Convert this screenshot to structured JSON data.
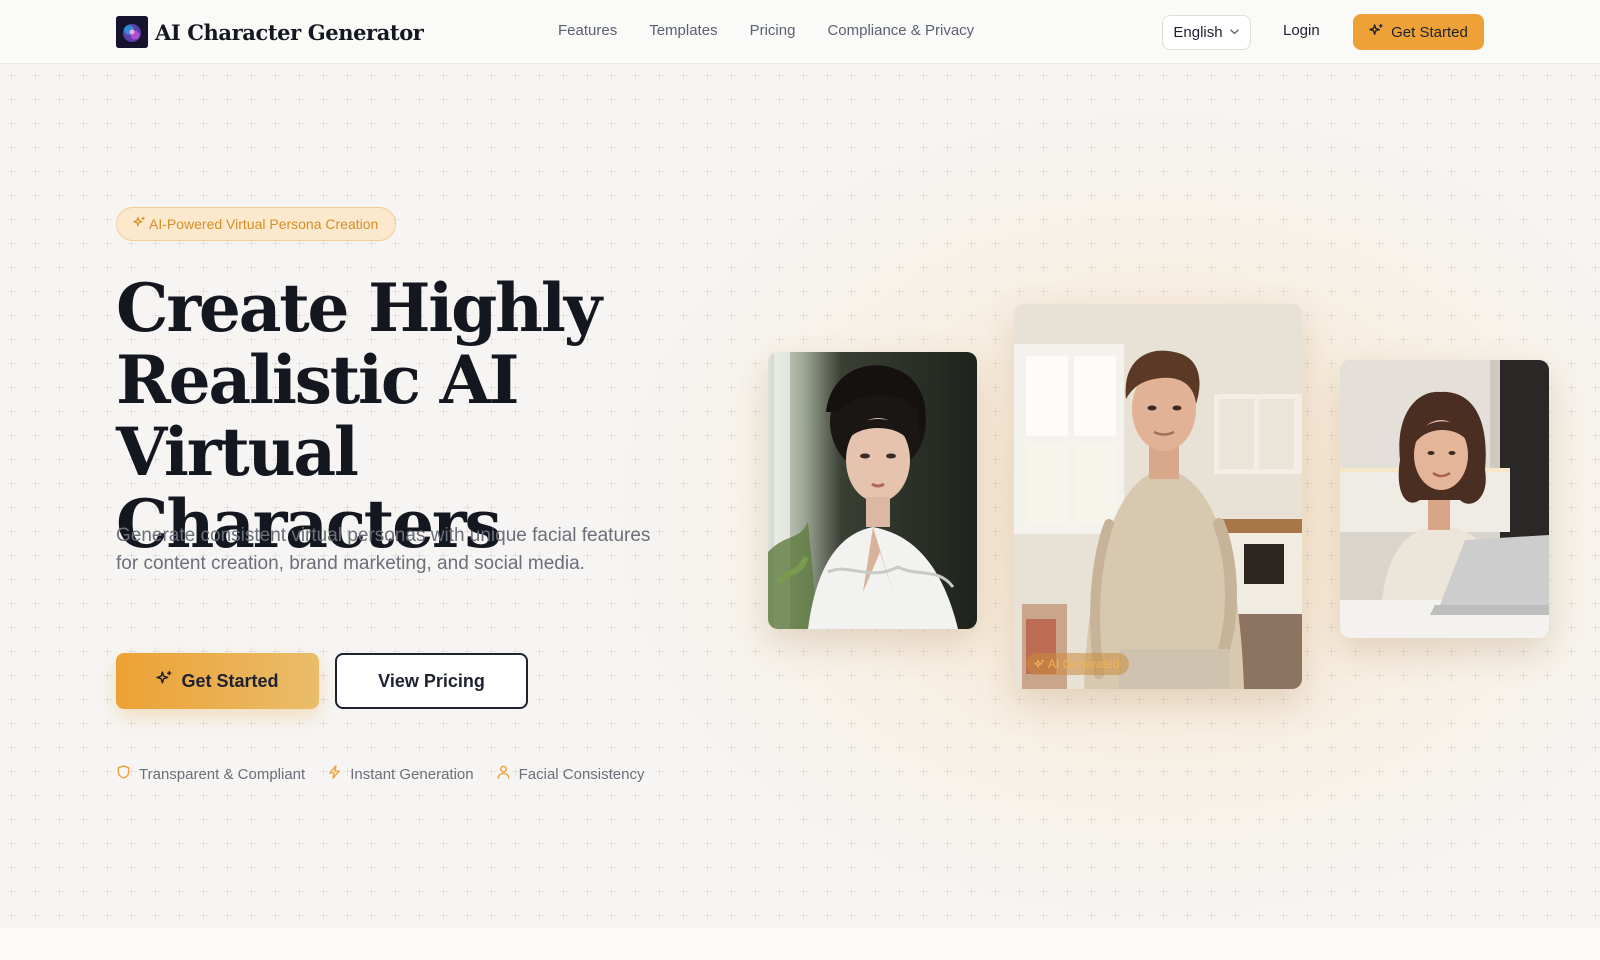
{
  "header": {
    "brand_name": "AI Character Generator",
    "nav": [
      "Features",
      "Templates",
      "Pricing",
      "Compliance & Privacy"
    ],
    "language": "English",
    "login": "Login",
    "cta": "Get Started"
  },
  "hero": {
    "pill": "AI-Powered Virtual Persona Creation",
    "headline": "Create Highly Realistic AI Virtual Characters",
    "subhead": "Generate consistent virtual personas with unique facial features for content creation, brand marketing, and social media.",
    "primary_cta": "Get Started",
    "secondary_cta": "View Pricing",
    "features": [
      "Transparent & Compliant",
      "Instant Generation",
      "Facial Consistency"
    ],
    "badge": "AI Generated"
  },
  "colors": {
    "accent": "#eda136",
    "accent_light": "#fbe8cd",
    "text_dark": "#14171f",
    "text_muted": "#6b6f79"
  },
  "icons": [
    "sparkle-icon",
    "chevron-down-icon",
    "shield-icon",
    "lightning-icon",
    "user-icon"
  ]
}
